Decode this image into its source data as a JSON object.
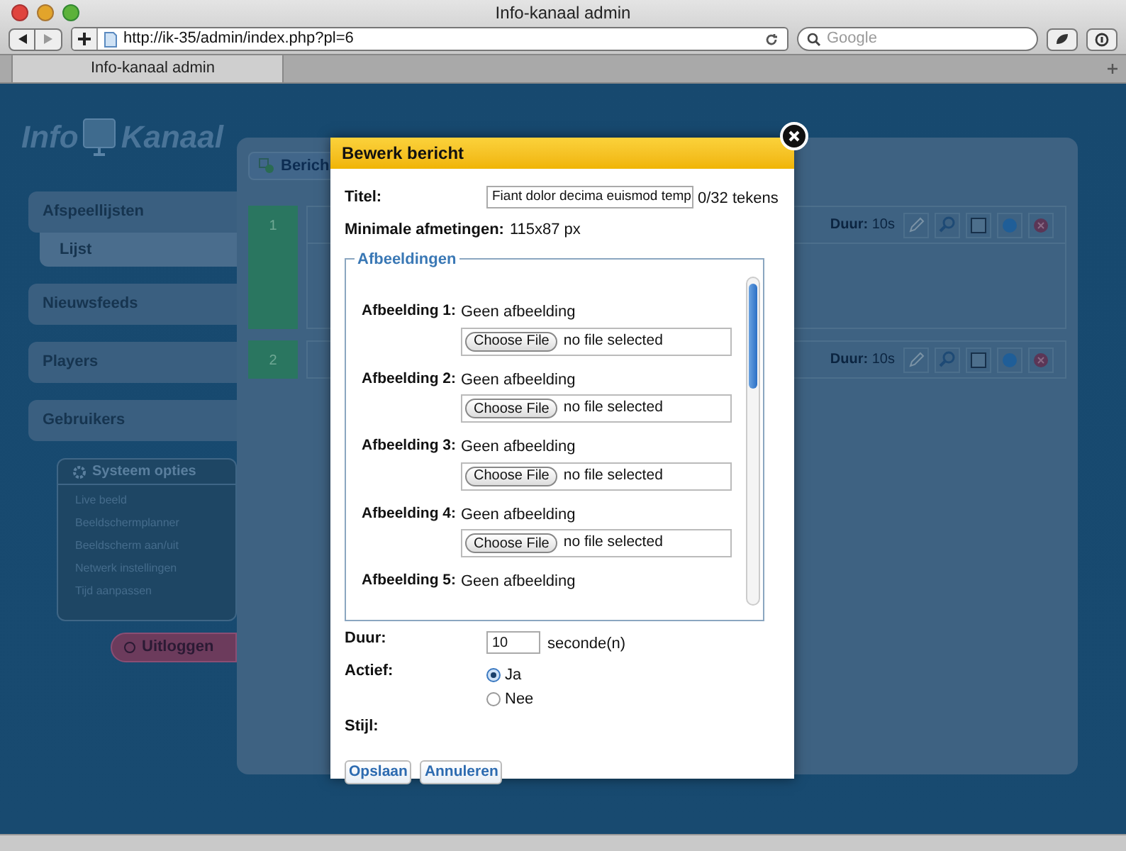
{
  "browser": {
    "title": "Info-kanaal admin",
    "url": "http://ik-35/admin/index.php?pl=6",
    "search_placeholder": "Google",
    "tab": "Info-kanaal admin"
  },
  "logo": {
    "word_1": "Info",
    "word_2": "Kanaal"
  },
  "sidebar": {
    "items": [
      {
        "label": "Afspeellijsten",
        "children": [
          {
            "label": "Lijst"
          }
        ]
      },
      {
        "label": "Nieuwsfeeds"
      },
      {
        "label": "Players"
      },
      {
        "label": "Gebruikers"
      }
    ]
  },
  "system_options": {
    "title": "Systeem opties",
    "items": [
      "Live beeld",
      "Beeldschermplanner",
      "Beeldscherm aan/uit",
      "Netwerk instellingen",
      "Tijd aanpassen"
    ]
  },
  "logout": "Uitloggen",
  "main": {
    "new_button": "Berich",
    "rows": [
      {
        "number": "1",
        "duration_label": "Duur:",
        "duration": "10s",
        "expanded": true
      },
      {
        "number": "2",
        "duration_label": "Duur:",
        "duration": "10s",
        "expanded": false
      }
    ]
  },
  "modal": {
    "title": "Bewerk bericht",
    "title_label": "Titel:",
    "title_value": "Fiant dolor decima euismod temp",
    "counter": "0/32 tekens",
    "min_label": "Minimale afmetingen:",
    "min_value": "115x87 px",
    "legend": "Afbeeldingen",
    "images": [
      {
        "label": "Afbeelding 1:",
        "status": "Geen afbeelding",
        "button": "Choose File",
        "file": "no file selected"
      },
      {
        "label": "Afbeelding 2:",
        "status": "Geen afbeelding",
        "button": "Choose File",
        "file": "no file selected"
      },
      {
        "label": "Afbeelding 3:",
        "status": "Geen afbeelding",
        "button": "Choose File",
        "file": "no file selected"
      },
      {
        "label": "Afbeelding 4:",
        "status": "Geen afbeelding",
        "button": "Choose File",
        "file": "no file selected"
      },
      {
        "label": "Afbeelding 5:",
        "status": "Geen afbeelding"
      }
    ],
    "duration_label": "Duur:",
    "duration_value": "10",
    "duration_unit": "seconde(n)",
    "active_label": "Actief:",
    "active_options": [
      {
        "label": "Ja",
        "selected": true
      },
      {
        "label": "Nee",
        "selected": false
      }
    ],
    "style_label": "Stijl:",
    "buttons": [
      "Opslaan",
      "Annuleren"
    ]
  }
}
